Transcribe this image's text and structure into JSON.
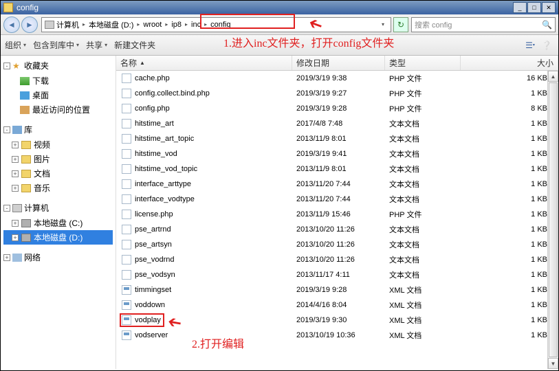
{
  "title": "config",
  "breadcrumb": [
    "计算机",
    "本地磁盘 (D:)",
    "wroot",
    "ip8",
    "inc",
    "config"
  ],
  "search_placeholder": "搜索 config",
  "toolbar": {
    "organize": "组织",
    "include": "包含到库中",
    "share": "共享",
    "newfolder": "新建文件夹"
  },
  "side": {
    "favorites": "收藏夹",
    "fav_items": [
      "下载",
      "桌面",
      "最近访问的位置"
    ],
    "libraries": "库",
    "lib_items": [
      "视频",
      "图片",
      "文档",
      "音乐"
    ],
    "computer": "计算机",
    "drives": [
      "本地磁盘 (C:)",
      "本地磁盘 (D:)"
    ],
    "network": "网络"
  },
  "columns": {
    "name": "名称",
    "date": "修改日期",
    "type": "类型",
    "size": "大小"
  },
  "files": [
    {
      "name": "cache.php",
      "date": "2019/3/19 9:38",
      "type": "PHP 文件",
      "size": "16 KB",
      "icon": "php"
    },
    {
      "name": "config.collect.bind.php",
      "date": "2019/3/19 9:27",
      "type": "PHP 文件",
      "size": "1 KB",
      "icon": "php"
    },
    {
      "name": "config.php",
      "date": "2019/3/19 9:28",
      "type": "PHP 文件",
      "size": "8 KB",
      "icon": "php"
    },
    {
      "name": "hitstime_art",
      "date": "2017/4/8 7:48",
      "type": "文本文档",
      "size": "1 KB",
      "icon": "txt"
    },
    {
      "name": "hitstime_art_topic",
      "date": "2013/11/9 8:01",
      "type": "文本文档",
      "size": "1 KB",
      "icon": "txt"
    },
    {
      "name": "hitstime_vod",
      "date": "2019/3/19 9:41",
      "type": "文本文档",
      "size": "1 KB",
      "icon": "txt"
    },
    {
      "name": "hitstime_vod_topic",
      "date": "2013/11/9 8:01",
      "type": "文本文档",
      "size": "1 KB",
      "icon": "txt"
    },
    {
      "name": "interface_arttype",
      "date": "2013/11/20 7:44",
      "type": "文本文档",
      "size": "1 KB",
      "icon": "txt"
    },
    {
      "name": "interface_vodtype",
      "date": "2013/11/20 7:44",
      "type": "文本文档",
      "size": "1 KB",
      "icon": "txt"
    },
    {
      "name": "license.php",
      "date": "2013/11/9 15:46",
      "type": "PHP 文件",
      "size": "1 KB",
      "icon": "php"
    },
    {
      "name": "pse_artrnd",
      "date": "2013/10/20 11:26",
      "type": "文本文档",
      "size": "1 KB",
      "icon": "txt"
    },
    {
      "name": "pse_artsyn",
      "date": "2013/10/20 11:26",
      "type": "文本文档",
      "size": "1 KB",
      "icon": "txt"
    },
    {
      "name": "pse_vodrnd",
      "date": "2013/10/20 11:26",
      "type": "文本文档",
      "size": "1 KB",
      "icon": "txt"
    },
    {
      "name": "pse_vodsyn",
      "date": "2013/11/17 4:11",
      "type": "文本文档",
      "size": "1 KB",
      "icon": "txt"
    },
    {
      "name": "timmingset",
      "date": "2019/3/19 9:28",
      "type": "XML 文档",
      "size": "1 KB",
      "icon": "xml"
    },
    {
      "name": "voddown",
      "date": "2014/4/16 8:04",
      "type": "XML 文档",
      "size": "1 KB",
      "icon": "xml"
    },
    {
      "name": "vodplay",
      "date": "2019/3/19 9:30",
      "type": "XML 文档",
      "size": "1 KB",
      "icon": "xml"
    },
    {
      "name": "vodserver",
      "date": "2013/10/19 10:36",
      "type": "XML 文档",
      "size": "1 KB",
      "icon": "xml"
    }
  ],
  "annotations": {
    "step1": "1.进入inc文件夹，打开config文件夹",
    "step2": "2.打开编辑"
  }
}
